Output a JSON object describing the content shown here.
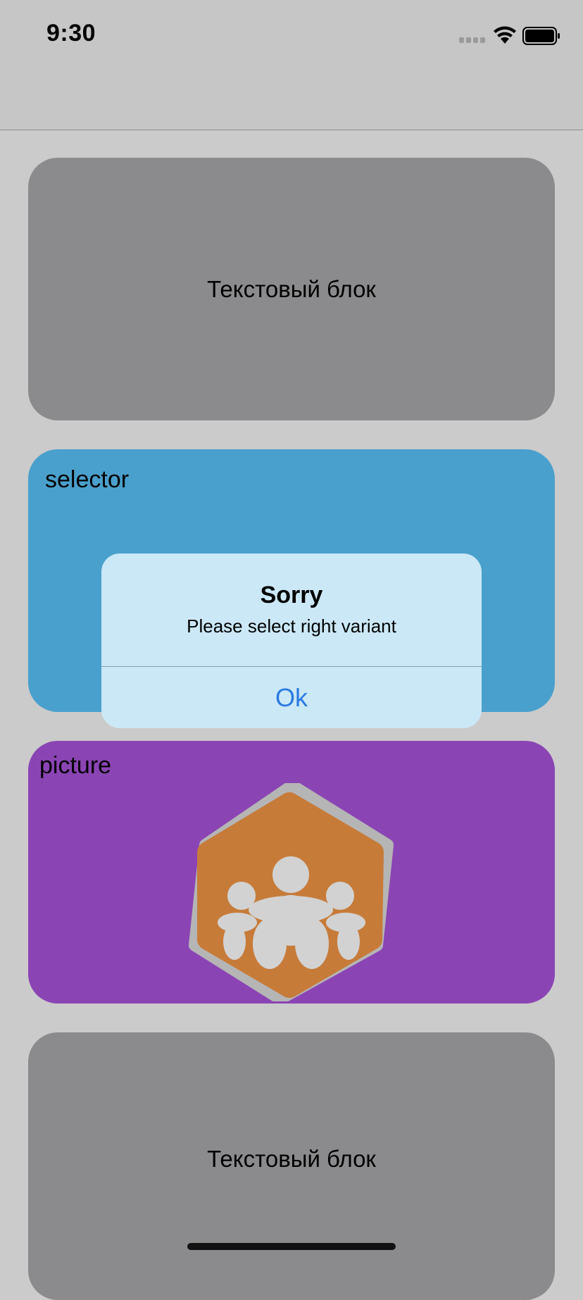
{
  "status_bar": {
    "time": "9:30",
    "icons": [
      "signal-icon",
      "wifi-icon",
      "battery-icon"
    ]
  },
  "colors": {
    "background": "#cbcbcb",
    "text_card": "#8b8b8d",
    "selector_card": "#4aa0cc",
    "picture_card": "#8b44b4",
    "dialog_background": "#cbe8f6",
    "dialog_button": "#2a7ae2",
    "logo_orange": "#c77b39",
    "logo_gray": "#b5b5b5"
  },
  "cards": [
    {
      "type": "text",
      "text": "Текстовый блок"
    },
    {
      "type": "selector",
      "label": "selector"
    },
    {
      "type": "picture",
      "label": "picture",
      "icon": "people-logo-icon"
    },
    {
      "type": "text",
      "text": "Текстовый блок"
    }
  ],
  "alert": {
    "title": "Sorry",
    "message": "Please select right variant",
    "button_label": "Ok"
  }
}
